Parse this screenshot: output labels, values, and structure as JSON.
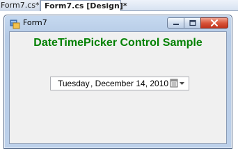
{
  "ide": {
    "tabs": [
      {
        "label": "Form7.cs*",
        "active": false
      },
      {
        "label": "Form7.cs [Design]*",
        "active": true
      }
    ]
  },
  "form": {
    "title": "Form7",
    "heading": "DateTimePicker Control Sample",
    "heading_color": "#008000",
    "datetimepicker": {
      "day": "Tuesday",
      "date": ", December 14, 2010",
      "dropdown_icon": "calendar-dropdown-icon"
    }
  },
  "colors": {
    "client_background": "#f0f0f0",
    "close_button": "#d9553b",
    "titlebar": "#c6d9f0"
  }
}
